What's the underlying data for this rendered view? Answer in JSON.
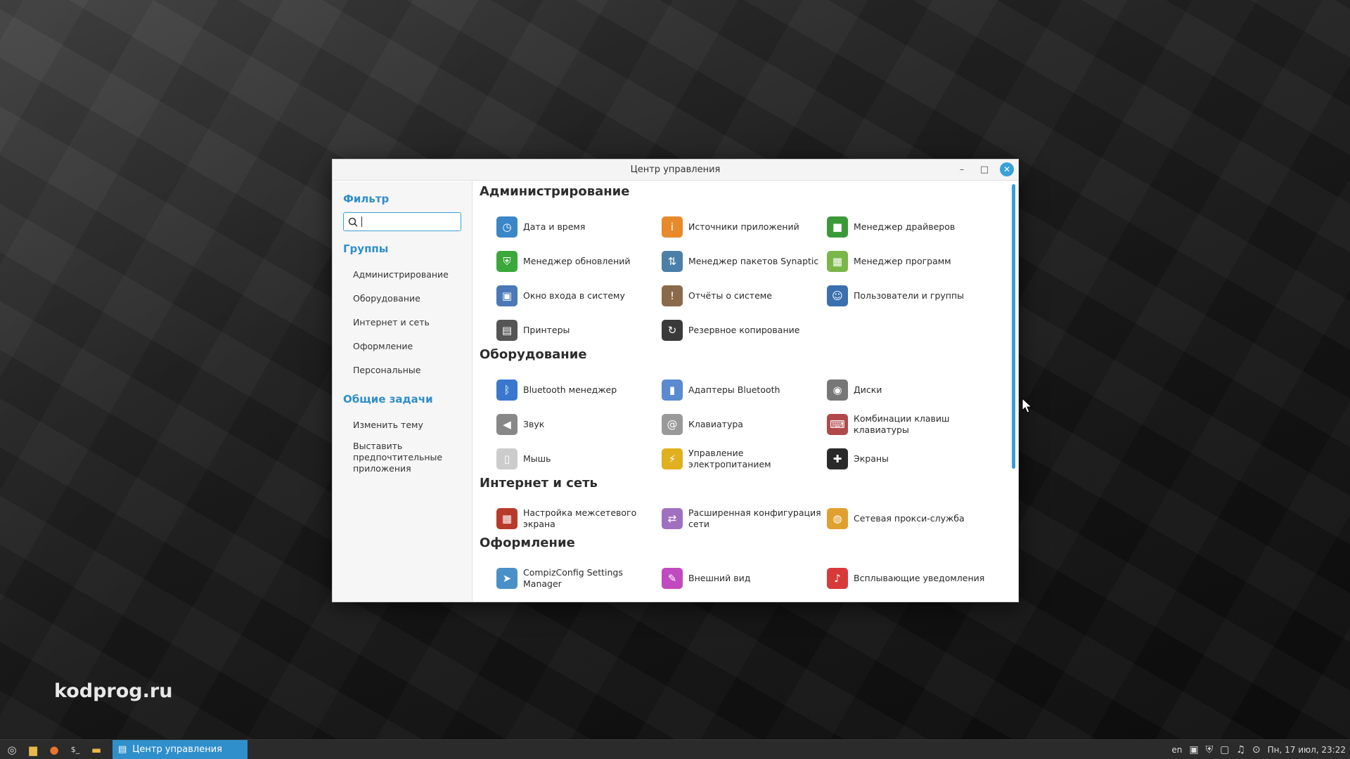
{
  "watermark": "kodprog.ru",
  "window": {
    "title": "Центр управления",
    "minimize_glyph": "–",
    "maximize_glyph": "□",
    "close_glyph": "✕"
  },
  "sidebar": {
    "filter_heading": "Фильтр",
    "search_value": "",
    "groups_heading": "Группы",
    "groups": [
      "Администрирование",
      "Оборудование",
      "Интернет и сеть",
      "Оформление",
      "Персональные"
    ],
    "tasks_heading": "Общие задачи",
    "tasks": [
      "Изменить тему",
      "Выставить предпочтительные приложения"
    ]
  },
  "sections": [
    {
      "title": "Администрирование",
      "items": [
        {
          "label": "Дата и время",
          "icon": "clock-icon",
          "color": "#3a86c8"
        },
        {
          "label": "Источники приложений",
          "icon": "info-icon",
          "color": "#e8892b"
        },
        {
          "label": "Менеджер драйверов",
          "icon": "chip-icon",
          "color": "#3a9a3a"
        },
        {
          "label": "Менеджер обновлений",
          "icon": "shield-icon",
          "color": "#3aa83a"
        },
        {
          "label": "Менеджер пакетов Synaptic",
          "icon": "package-icon",
          "color": "#4a7fa8"
        },
        {
          "label": "Менеджер программ",
          "icon": "grid-icon",
          "color": "#7ab648"
        },
        {
          "label": "Окно входа в систему",
          "icon": "login-icon",
          "color": "#4a78b8"
        },
        {
          "label": "Отчёты о системе",
          "icon": "report-icon",
          "color": "#8a6a4a"
        },
        {
          "label": "Пользователи и группы",
          "icon": "users-icon",
          "color": "#3a6fb0"
        },
        {
          "label": "Принтеры",
          "icon": "printer-icon",
          "color": "#555555"
        },
        {
          "label": "Резервное копирование",
          "icon": "backup-icon",
          "color": "#3a3a3a"
        }
      ]
    },
    {
      "title": "Оборудование",
      "items": [
        {
          "label": "Bluetooth менеджер",
          "icon": "bluetooth-icon",
          "color": "#3a78d0"
        },
        {
          "label": "Адаптеры Bluetooth",
          "icon": "bluetooth-adapter-icon",
          "color": "#5a8ad0"
        },
        {
          "label": "Диски",
          "icon": "disk-icon",
          "color": "#777777"
        },
        {
          "label": "Звук",
          "icon": "speaker-icon",
          "color": "#888888"
        },
        {
          "label": "Клавиатура",
          "icon": "keyboard-icon",
          "color": "#999999"
        },
        {
          "label": "Комбинации клавиш клавиатуры",
          "icon": "shortcuts-icon",
          "color": "#b04a4a"
        },
        {
          "label": "Мышь",
          "icon": "mouse-icon",
          "color": "#cccccc"
        },
        {
          "label": "Управление электропитанием",
          "icon": "power-icon",
          "color": "#e0b020"
        },
        {
          "label": "Экраны",
          "icon": "display-icon",
          "color": "#2a2a2a"
        }
      ]
    },
    {
      "title": "Интернет и сеть",
      "items": [
        {
          "label": "Настройка межсетевого экрана",
          "icon": "firewall-icon",
          "color": "#b83a2a"
        },
        {
          "label": "Расширенная конфигурация сети",
          "icon": "network-icon",
          "color": "#a070c0"
        },
        {
          "label": "Сетевая прокси-служба",
          "icon": "proxy-icon",
          "color": "#e0a030"
        }
      ]
    },
    {
      "title": "Оформление",
      "items": [
        {
          "label": "CompizConfig Settings Manager",
          "icon": "compiz-icon",
          "color": "#4a90c8"
        },
        {
          "label": "Внешний вид",
          "icon": "brush-icon",
          "color": "#c04ac0"
        },
        {
          "label": "Всплывающие уведомления",
          "icon": "bell-icon",
          "color": "#d83a3a"
        }
      ]
    }
  ],
  "taskbar": {
    "task_label": "Центр управления",
    "lang": "en",
    "clock": "Пн, 17 июл, 23:22"
  }
}
